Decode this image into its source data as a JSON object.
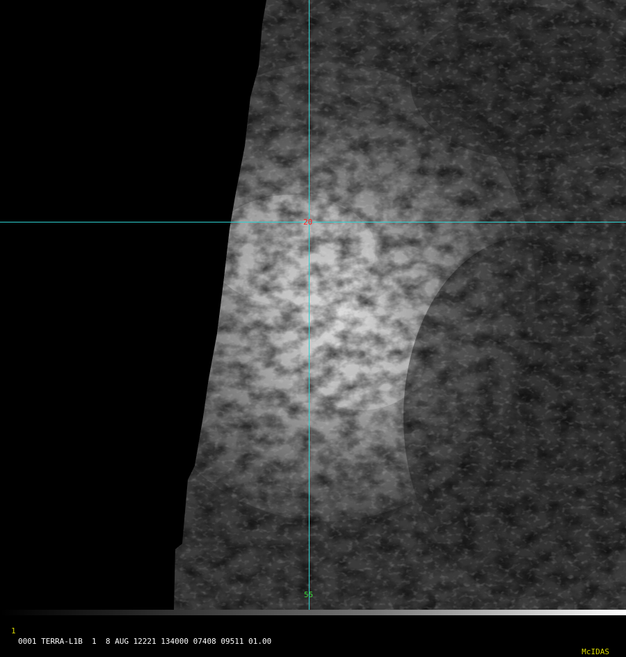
{
  "overlay": {
    "latitude_label": "20",
    "longitude_label": "55",
    "line_color": "#2fd4d4",
    "latitude_label_color": "#ff2020",
    "longitude_label_color": "#39d739"
  },
  "status_bar": {
    "frame_index": "1",
    "caption": "0001 TERRA-L1B  1  8 AUG 12221 134000 07408 09511 01.00",
    "brand": "McIDAS"
  }
}
